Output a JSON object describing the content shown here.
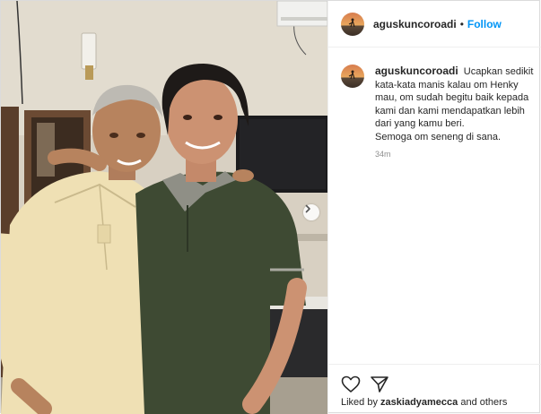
{
  "post": {
    "username": "aguskuncoroadi",
    "separator": "•",
    "follow_label": "Follow"
  },
  "caption": {
    "username": "aguskuncoroadi",
    "lines": [
      "Ucapkan sedikit",
      "kata-kata manis kalau om Henky",
      "mau, om sudah begitu baik kepada",
      "kami dan kami mendapatkan lebih",
      "dari yang kamu beri.",
      "Semoga om seneng di sana."
    ],
    "time": "34m"
  },
  "footer": {
    "liked_prefix": "Liked by",
    "liked_user": "zaskiadyamecca",
    "liked_suffix": "and others"
  },
  "icons": {
    "like": "heart-icon",
    "share": "paper-plane-icon",
    "next": "chevron-right-icon"
  },
  "colors": {
    "accent": "#0095f6",
    "text": "#262626",
    "muted": "#8e8e8e"
  }
}
